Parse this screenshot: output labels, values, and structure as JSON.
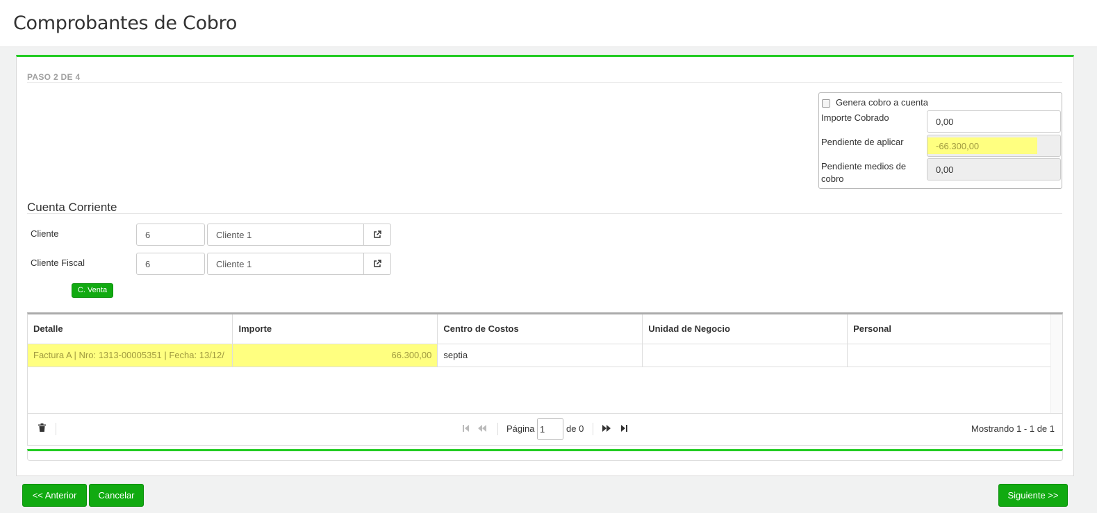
{
  "header": {
    "title": "Comprobantes de Cobro"
  },
  "step": {
    "label": "PASO 2 DE 4"
  },
  "summary": {
    "checkbox_label": "Genera cobro a cuenta",
    "importe_cobrado_label": "Importe Cobrado",
    "importe_cobrado_value": "0,00",
    "pendiente_aplicar_label": "Pendiente de aplicar",
    "pendiente_aplicar_value": "-66.300,00",
    "pendiente_medios_label": "Pendiente medios de cobro",
    "pendiente_medios_value": "0,00"
  },
  "cuenta": {
    "title": "Cuenta Corriente",
    "cliente_label": "Cliente",
    "cliente_code": "6",
    "cliente_name": "Cliente 1",
    "cliente_fiscal_label": "Cliente Fiscal",
    "cliente_fiscal_code": "6",
    "cliente_fiscal_name": "Cliente 1",
    "cventa_label": "C. Venta"
  },
  "grid": {
    "columns": [
      "Detalle",
      "Importe",
      "Centro de Costos",
      "Unidad de Negocio",
      "Personal"
    ],
    "rows": [
      {
        "detalle": "Factura A | Nro: 1313-00005351 | Fecha: 13/12/",
        "importe": "66.300,00",
        "centro": "septia",
        "unidad": "",
        "personal": ""
      }
    ],
    "pager": {
      "page_label": "Página",
      "page_value": "1",
      "of_label": "de 0",
      "showing": "Mostrando 1 - 1 de 1"
    }
  },
  "buttons": {
    "anterior": "<< Anterior",
    "cancelar": "Cancelar",
    "siguiente": "Siguiente >>"
  },
  "colors": {
    "accent_green": "#22cc22",
    "button_green": "#11aa11",
    "highlight": "#ffff80"
  },
  "icons": [
    "external-link-icon",
    "trash-icon",
    "first-page-icon",
    "prev-page-icon",
    "next-page-icon",
    "last-page-icon"
  ]
}
